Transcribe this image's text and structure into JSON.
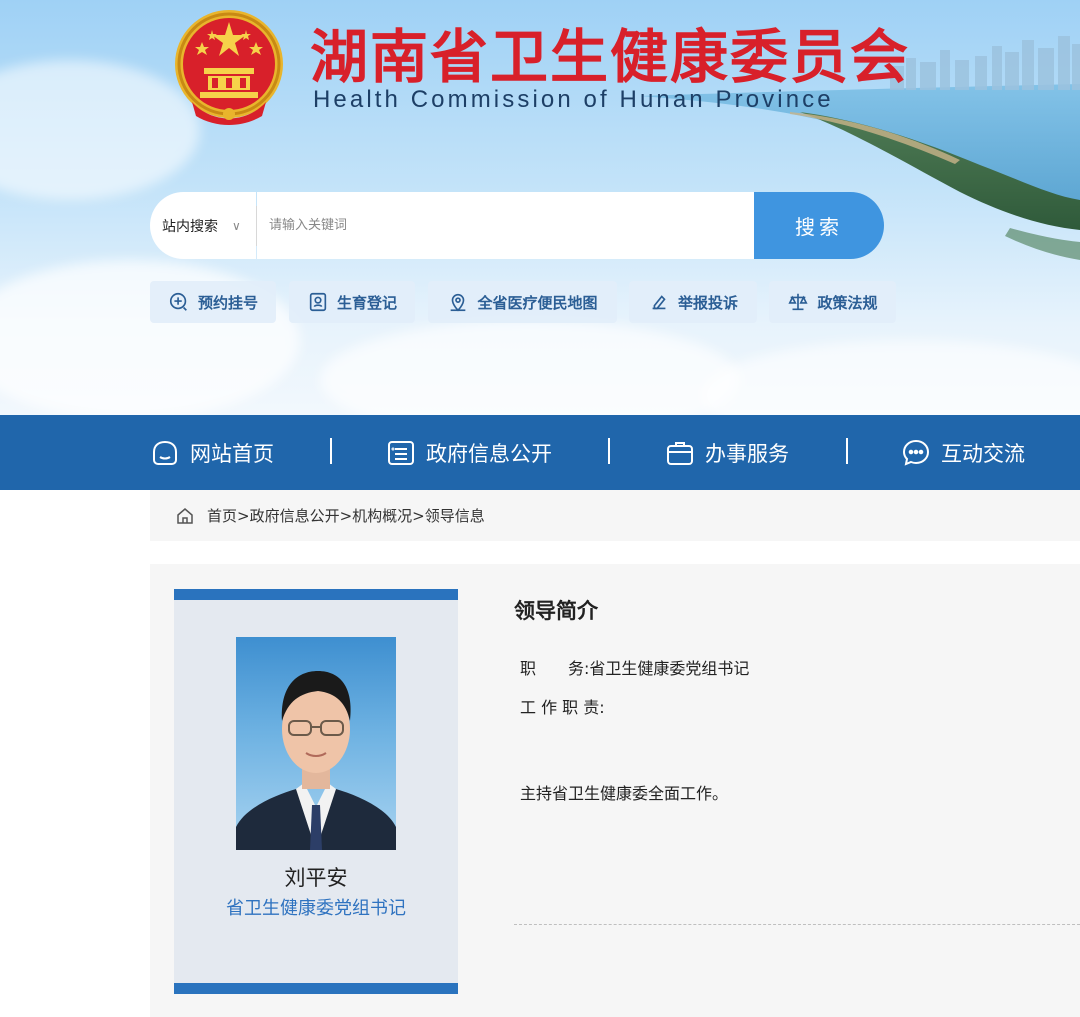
{
  "site": {
    "title_cn": "湖南省卫生健康委员会",
    "title_en": "Health Commission of Hunan Province"
  },
  "search": {
    "scope_label": "站内搜索",
    "placeholder": "请输入关键词",
    "button_label": "搜索"
  },
  "quick_links": [
    {
      "label": "预约挂号",
      "icon": "appointment-icon"
    },
    {
      "label": "生育登记",
      "icon": "registration-icon"
    },
    {
      "label": "全省医疗便民地图",
      "icon": "map-pin-icon"
    },
    {
      "label": "举报投诉",
      "icon": "report-icon"
    },
    {
      "label": "政策法规",
      "icon": "scales-icon"
    }
  ],
  "nav": [
    {
      "label": "网站首页",
      "icon": "home-icon"
    },
    {
      "label": "政府信息公开",
      "icon": "document-list-icon"
    },
    {
      "label": "办事服务",
      "icon": "briefcase-icon"
    },
    {
      "label": "互动交流",
      "icon": "chat-icon"
    }
  ],
  "breadcrumb": "首页>政府信息公开>机构概况>领导信息",
  "leader": {
    "name": "刘平安",
    "title": "省卫生健康委党组书记"
  },
  "profile": {
    "heading": "领导简介",
    "position_label": "职　　务:",
    "position_value": "省卫生健康委党组书记",
    "duties_label": "工 作 职 责:",
    "duties_value": "主持省卫生健康委全面工作。"
  },
  "colors": {
    "nav_blue": "#2066ab",
    "title_red": "#d8202a",
    "accent_blue": "#2a73be",
    "search_button": "#3f95e0"
  }
}
